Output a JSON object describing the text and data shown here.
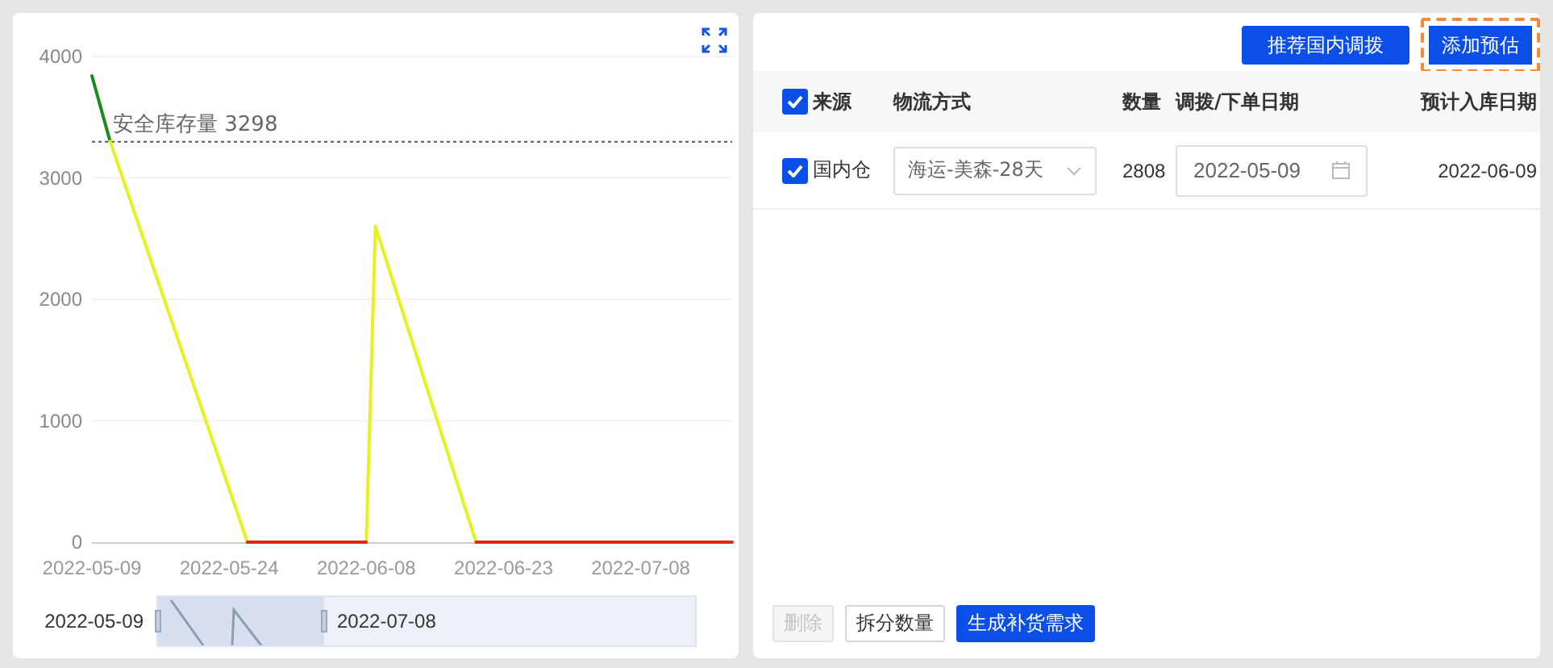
{
  "chart_panel": {
    "chart_data": {
      "type": "line",
      "grid": true,
      "x": [
        "2022-05-09",
        "2022-05-11",
        "2022-05-26",
        "2022-06-08",
        "2022-06-09",
        "2022-06-20",
        "2022-07-18"
      ],
      "series": [
        {
          "color": "#1f8a1f",
          "values": [
            3840,
            3300,
            null,
            null,
            null,
            null,
            null
          ]
        },
        {
          "color": "#e8f01e",
          "values": [
            null,
            3300,
            0,
            0,
            2600,
            0,
            null
          ]
        },
        {
          "color": "#e0261b",
          "values": [
            null,
            null,
            0,
            0,
            null,
            0,
            0
          ]
        }
      ],
      "xlim": [
        "2022-05-09",
        "2022-07-18"
      ],
      "ylim": [
        0,
        4000
      ],
      "xticks": [
        {
          "value": "2022-05-09",
          "label": "2022-05-09"
        },
        {
          "value": "2022-05-24",
          "label": "2022-05-24"
        },
        {
          "value": "2022-06-08",
          "label": "2022-06-08"
        },
        {
          "value": "2022-06-23",
          "label": "2022-06-23"
        },
        {
          "value": "2022-07-08",
          "label": "2022-07-08"
        }
      ],
      "yticks": [
        0,
        1000,
        2000,
        3000,
        4000
      ],
      "ref_lines": [
        {
          "axis": "y",
          "value": 3298,
          "label": "安全库存量 3298"
        }
      ]
    },
    "zoom_slider": {
      "start_label": "2022-05-09",
      "end_label": "2022-07-08"
    }
  },
  "table_panel": {
    "buttons": [
      {
        "label": "推荐国内调拨",
        "focused": false
      },
      {
        "label": "添加预估",
        "focused": true
      }
    ],
    "columns": [
      {
        "label": "来源"
      },
      {
        "label": "物流方式"
      },
      {
        "label": "数量"
      },
      {
        "label": "调拨/下单日期"
      },
      {
        "label": "预计入库日期"
      }
    ],
    "all_checked": true,
    "rows": [
      {
        "checked": true,
        "source": "国内仓",
        "shipping": "海运-美森-28天",
        "quantity": "2808",
        "order_date": "2022-05-09",
        "arrival_date": "2022-06-09"
      }
    ],
    "footer_buttons": [
      {
        "label": "删除",
        "kind": "plain",
        "disabled": true
      },
      {
        "label": "拆分数量",
        "kind": "plain",
        "disabled": false
      },
      {
        "label": "生成补货需求",
        "kind": "primary",
        "disabled": false
      }
    ]
  }
}
